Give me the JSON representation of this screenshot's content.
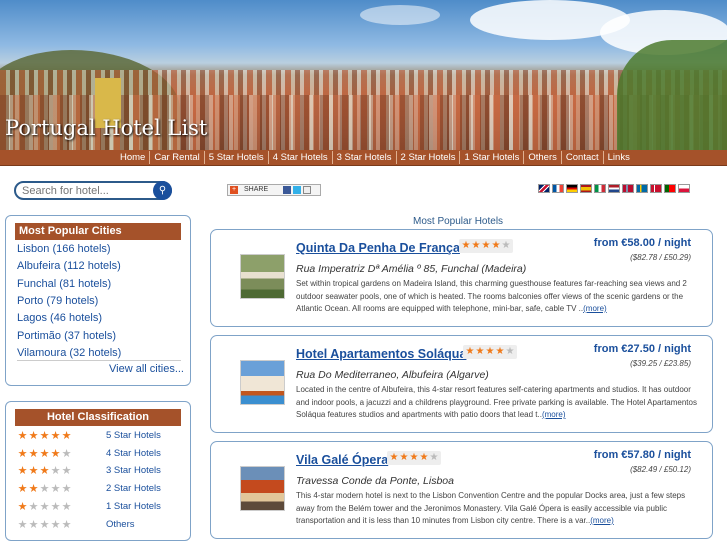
{
  "site": {
    "title": "Portugal Hotel List"
  },
  "nav": [
    "Home",
    "Car Rental",
    "5 Star Hotels",
    "4 Star Hotels",
    "3 Star Hotels",
    "2 Star Hotels",
    "1 Star Hotels",
    "Others",
    "Contact",
    "Links"
  ],
  "search": {
    "placeholder": "Search for hotel...",
    "button_icon": "search-icon"
  },
  "share": {
    "label": "SHARE"
  },
  "flags": [
    "uk-flag",
    "france-flag",
    "germany-flag",
    "spain-flag",
    "italy-flag",
    "netherlands-flag",
    "norway-flag",
    "sweden-flag",
    "denmark-flag",
    "portugal-flag",
    "poland-flag"
  ],
  "cities": {
    "title": "Most Popular Cities",
    "items": [
      "Lisbon (166 hotels)",
      "Albufeira (112 hotels)",
      "Funchal (81 hotels)",
      "Porto (79 hotels)",
      "Lagos (46 hotels)",
      "Portimão (37 hotels)",
      "Vilamoura (32 hotels)"
    ],
    "view_all": "View all cities..."
  },
  "classification": {
    "title": "Hotel Classification",
    "items": [
      {
        "stars": 5,
        "label": "5 Star Hotels"
      },
      {
        "stars": 4,
        "label": "4 Star Hotels"
      },
      {
        "stars": 3,
        "label": "3 Star Hotels"
      },
      {
        "stars": 2,
        "label": "2 Star Hotels"
      },
      {
        "stars": 1,
        "label": "1 Star Hotels"
      },
      {
        "stars": 0,
        "label": "Others"
      }
    ]
  },
  "main": {
    "title": "Most Popular Hotels",
    "hotels": [
      {
        "name": "Quinta Da Penha De França",
        "stars": 4,
        "address": "Rua Imperatriz Dª Amélia º 85, Funchal (Madeira)",
        "description": "Set within tropical gardens on Madeira Island, this charming guesthouse features far-reaching sea views and 2 outdoor seawater pools, one of which is heated. The rooms balconies offer views of the scenic gardens or the Atlantic Ocean. All rooms are equipped with telephone, mini-bar, safe, cable TV ..",
        "more": "(more)",
        "price": "from €58.00 / night",
        "converted": "($82.78 / £50.29)"
      },
      {
        "name": "Hotel Apartamentos Soláqua",
        "stars": 4,
        "address": "Rua Do Mediterraneo, Albufeira (Algarve)",
        "description": "Located in the centre of Albufeira, this 4-star resort features self-catering apartments and studios. It has outdoor and indoor pools, a jacuzzi and a childrens playground. Free private parking is available. The Hotel Apartamentos Soláqua features studios and apartments with patio doors that lead t..",
        "more": "(more)",
        "price": "from €27.50 / night",
        "converted": "($39.25 / £23.85)"
      },
      {
        "name": "Vila Galé Ópera",
        "stars": 4,
        "address": "Travessa Conde da Ponte, Lisboa",
        "description": "This 4-star modern hotel is next to the Lisbon Convention Centre and the popular Docks area, just a few steps away from the Belém tower and the Jeronimos Monastery. Vila Galé Ópera is easily accessible via public transportation and it is less than 10 minutes from Lisbon city centre. There is a var..",
        "more": "(more)",
        "price": "from €57.80 / night",
        "converted": "($82.49 / £50.12)"
      }
    ]
  },
  "colors": {
    "accent": "#a5522a",
    "link": "#1a4f9c",
    "border": "#7fa3c8",
    "star": "#f07a1a"
  }
}
